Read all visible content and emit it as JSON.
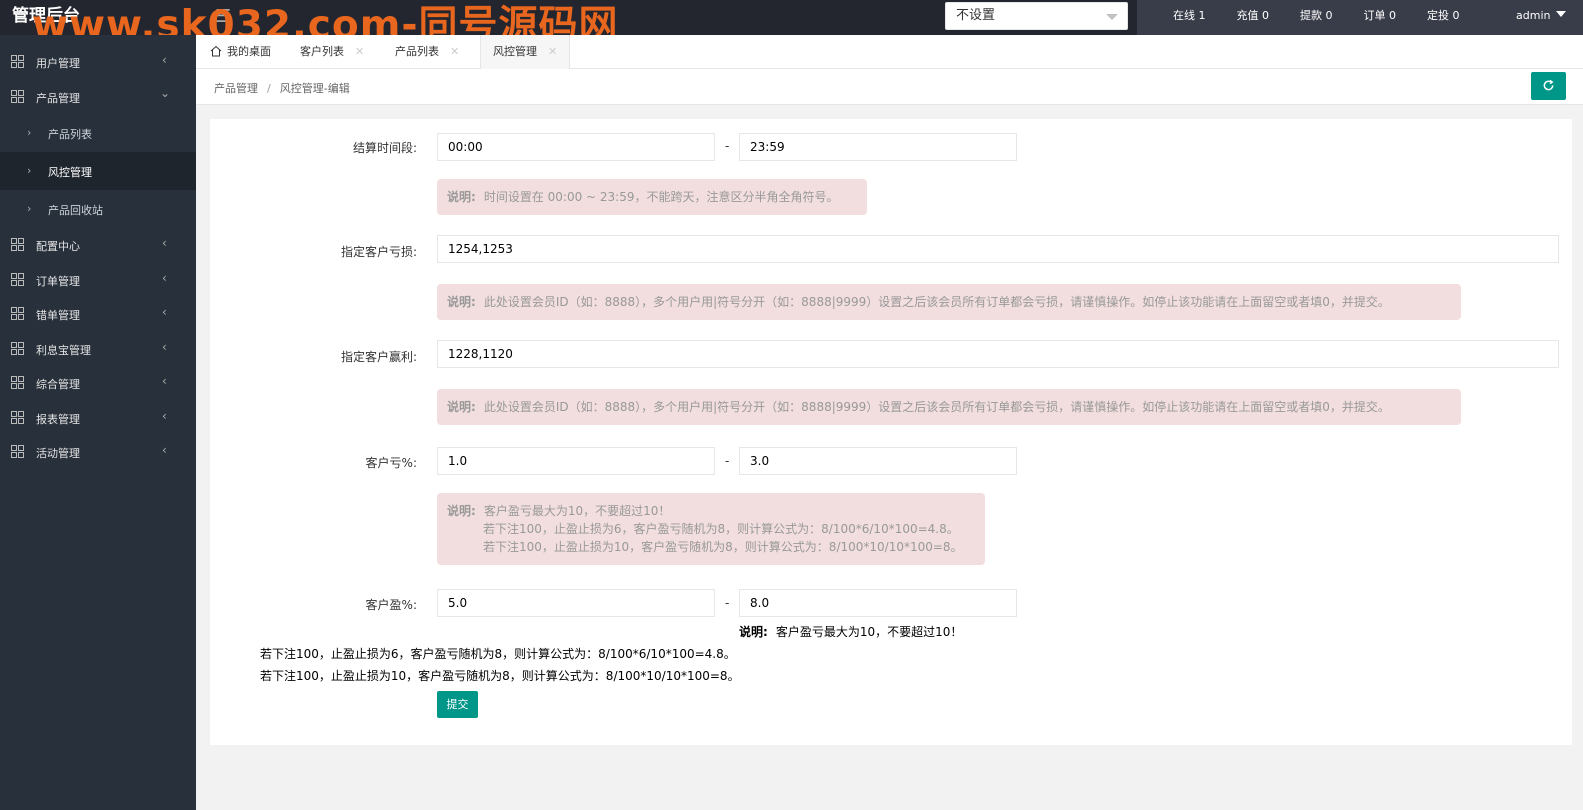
{
  "header": {
    "brand": "管理后台",
    "watermark": "www.sk032.com-同号源码网",
    "select_value": "不设置",
    "stats": [
      "在线 1",
      "充值 0",
      "提款 0",
      "订单 0",
      "定投 0"
    ],
    "user": "admin"
  },
  "sidebar": {
    "items": [
      {
        "label": "用户管理",
        "expanded": false
      },
      {
        "label": "产品管理",
        "expanded": true
      },
      {
        "label": "配置中心",
        "expanded": false
      },
      {
        "label": "订单管理",
        "expanded": false
      },
      {
        "label": "错单管理",
        "expanded": false
      },
      {
        "label": "利息宝管理",
        "expanded": false
      },
      {
        "label": "综合管理",
        "expanded": false
      },
      {
        "label": "报表管理",
        "expanded": false
      },
      {
        "label": "活动管理",
        "expanded": false
      }
    ],
    "sub_items": [
      {
        "label": "产品列表"
      },
      {
        "label": "风控管理"
      },
      {
        "label": "产品回收站"
      }
    ]
  },
  "tabs": [
    {
      "label": "我的桌面"
    },
    {
      "label": "客户列表"
    },
    {
      "label": "产品列表"
    },
    {
      "label": "风控管理"
    }
  ],
  "breadcrumb": {
    "parent": "产品管理",
    "sep": "/",
    "current": "风控管理-编辑"
  },
  "form": {
    "settle_time": {
      "label": "结算时间段:",
      "start": "00:00",
      "end": "23:59",
      "dash": "-"
    },
    "settle_note": {
      "prefix": "说明:",
      "text": "时间设置在 00:00 ~ 23:59，不能跨天，注意区分半角全角符号。"
    },
    "loss_ids": {
      "label": "指定客户亏损:",
      "value": "1254,1253"
    },
    "loss_note": {
      "prefix": "说明:",
      "text": "此处设置会员ID（如：8888），多个用户用|符号分开（如：8888|9999）设置之后该会员所有订单都会亏损，请谨慎操作。如停止该功能请在上面留空或者填0，并提交。"
    },
    "win_ids": {
      "label": "指定客户赢利:",
      "value": "1228,1120"
    },
    "win_note": {
      "prefix": "说明:",
      "text": "此处设置会员ID（如：8888），多个用户用|符号分开（如：8888|9999）设置之后该会员所有订单都会亏损，请谨慎操作。如停止该功能请在上面留空或者填0，并提交。"
    },
    "loss_pct": {
      "label": "客户亏%:",
      "min": "1.0",
      "max": "3.0",
      "dash": "-"
    },
    "pct_note": {
      "prefix": "说明:",
      "line1": "客户盈亏最大为10，不要超过10！",
      "line2": "若下注100，止盈止损为6，客户盈亏随机为8，则计算公式为：8/100*6/10*100=4.8。",
      "line3": "若下注100，止盈止损为10，客户盈亏随机为8，则计算公式为：8/100*10/10*100=8。"
    },
    "win_pct": {
      "label": "客户盈%:",
      "min": "5.0",
      "max": "8.0",
      "dash": "-"
    },
    "win_note_plain": {
      "prefix": "说明:",
      "line1": "客户盈亏最大为10，不要超过10！",
      "line2": "若下注100，止盈止损为6，客户盈亏随机为8，则计算公式为：8/100*6/10*100=4.8。",
      "line3": "若下注100，止盈止损为10，客户盈亏随机为8，则计算公式为：8/100*10/10*100=8。"
    },
    "submit": "提交"
  }
}
